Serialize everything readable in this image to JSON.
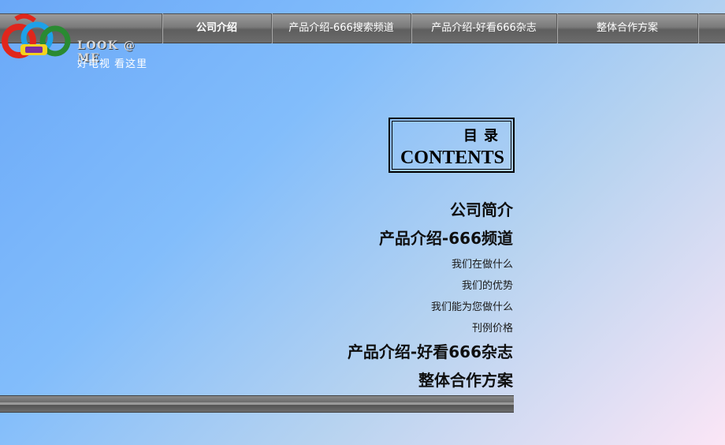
{
  "logo": {
    "icon": "666-logo-icon",
    "tagline_en": "LOOK @ ME",
    "tagline_cn": "好电视  看这里"
  },
  "nav": {
    "items": [
      {
        "label": "公司介绍",
        "active": true
      },
      {
        "label": "产品介绍-666搜索频道",
        "active": false
      },
      {
        "label": "产品介绍-好看666杂志",
        "active": false
      },
      {
        "label": "整体合作方案",
        "active": false
      }
    ]
  },
  "toc": {
    "title_cn": "目录",
    "title_en": "CONTENTS"
  },
  "menu": {
    "company_intro": "公司简介",
    "product_channel": "产品介绍-666频道",
    "sub_items": [
      "我们在做什么",
      "我们的优势",
      "我们能为您做什么",
      "刊例价格"
    ],
    "product_magazine": "产品介绍-好看666杂志",
    "cooperation": "整体合作方案"
  },
  "colors": {
    "background_start": "#6aa8f8",
    "background_end": "#fbe6f6",
    "bar": "#6b6b6b"
  }
}
